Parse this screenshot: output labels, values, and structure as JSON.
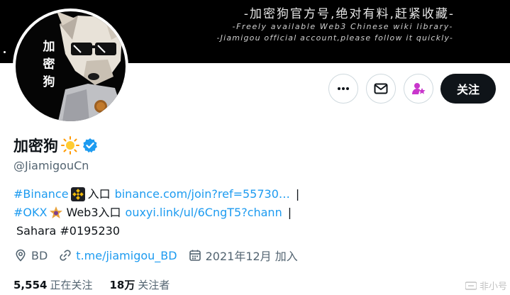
{
  "banner": {
    "line1": "-加密狗官方号,绝对有料,赶紧收藏-",
    "line2": "-Freely available Web3 Chinese wiki library-",
    "line3": "-Jiamigou official account,please follow it quickly-"
  },
  "avatar": {
    "text": "加密狗",
    "icon": "dog-with-sunglasses-avatar"
  },
  "actions": {
    "more_icon": "more-dots-icon",
    "message_icon": "envelope-icon",
    "subscribe_icon": "subscribe-star-icon",
    "follow_label": "关注"
  },
  "profile": {
    "display_name": "加密狗",
    "name_emoji": "sun-icon",
    "verified_icon": "verified-badge-icon",
    "handle": "@JiamigouCn"
  },
  "bio": {
    "line1": {
      "tag": "#Binance",
      "emoji": "binance-logo-icon",
      "text": "入口",
      "link": "binance.com/join?ref=55730…",
      "sep": "|"
    },
    "line2": {
      "tag": "#OKX",
      "emoji": "star-badge-icon",
      "text": "Web3入口",
      "link": "ouxyi.link/ul/6CngT5?chann",
      "sep": "|"
    },
    "line3": {
      "text": "Sahara #0195230"
    }
  },
  "meta": {
    "location": "BD",
    "website": "t.me/jiamigou_BD",
    "joined": "2021年12月 加入"
  },
  "stats": {
    "following_count": "5,554",
    "following_label": "正在关注",
    "followers_count": "18万",
    "followers_label": "关注者"
  },
  "watermark": {
    "text": "非小号"
  },
  "colors": {
    "link": "#1d9bf0",
    "text": "#0f1419",
    "muted": "#536471",
    "subscribe": "#c936cc",
    "binance": "#f0b90b"
  }
}
